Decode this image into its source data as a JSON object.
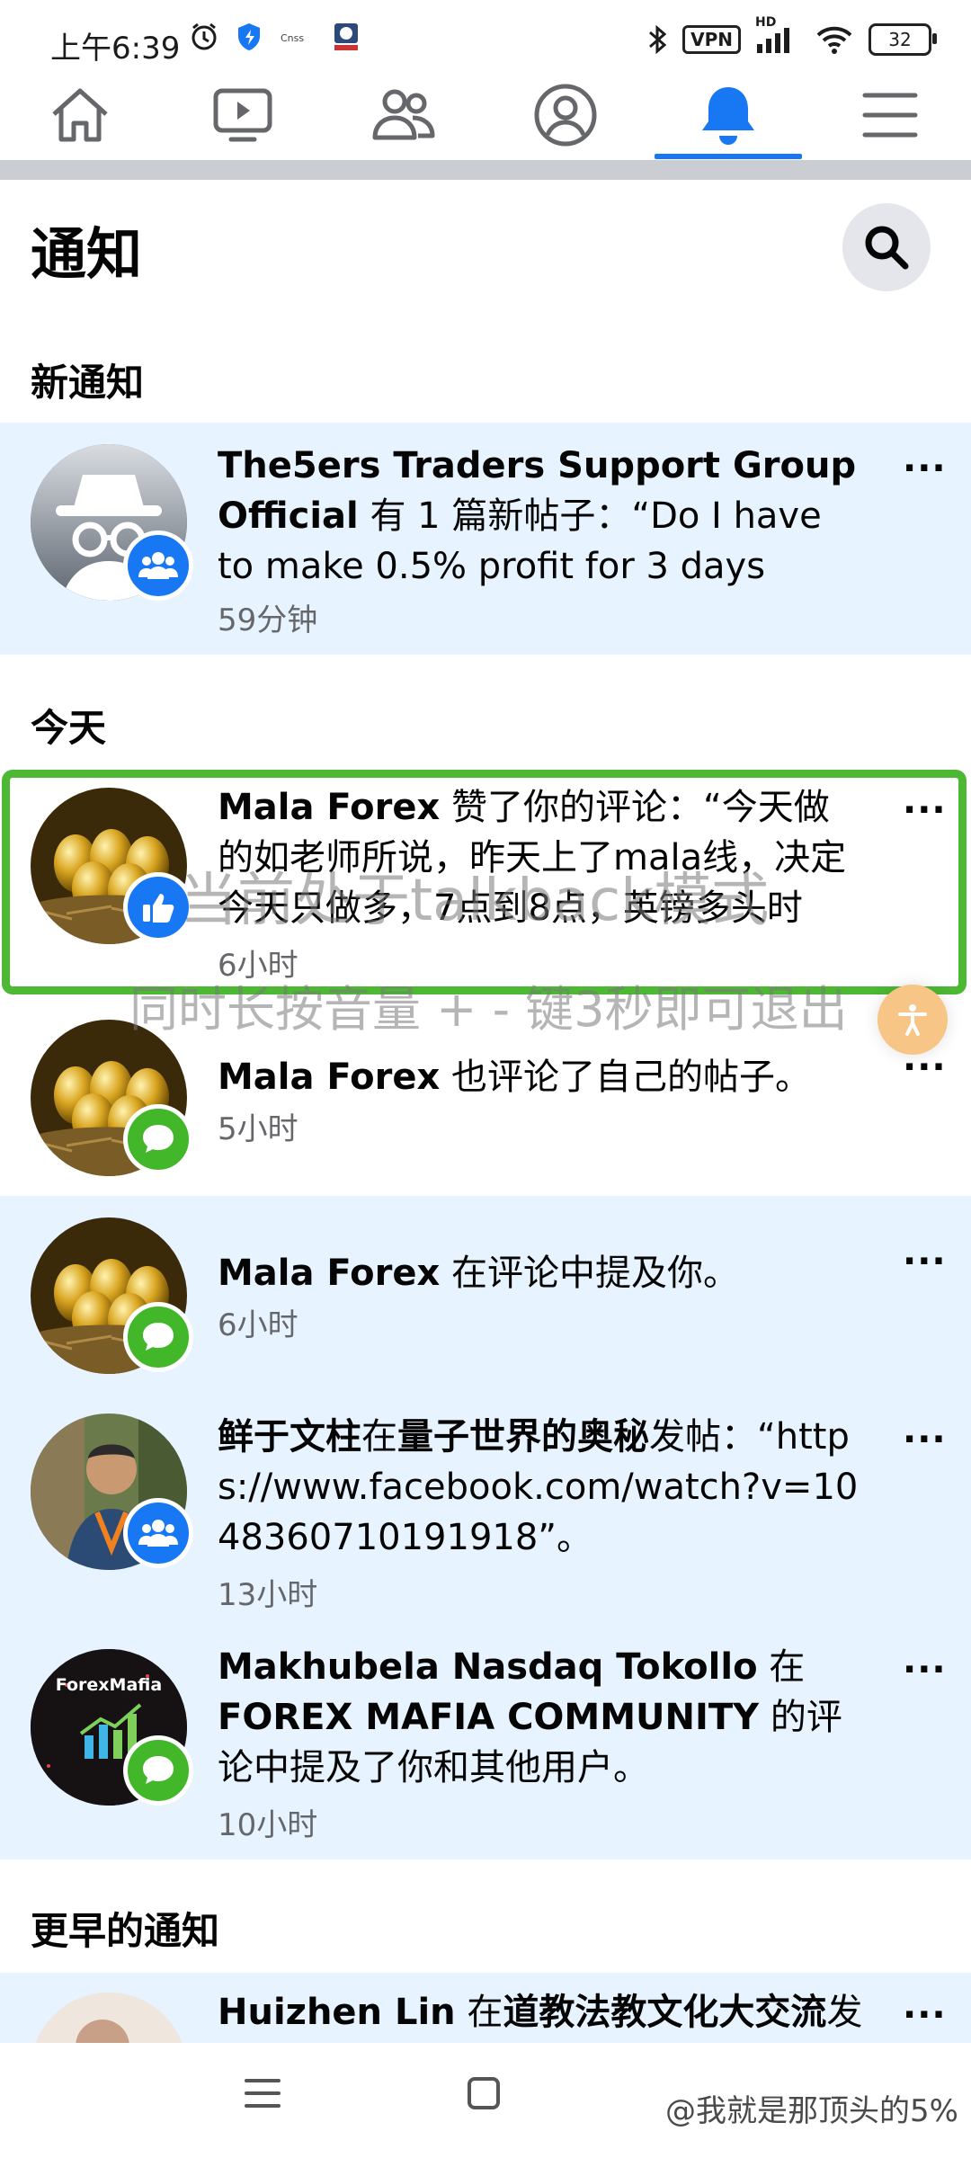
{
  "status_bar": {
    "time": "上午6:39",
    "vpn": "VPN",
    "hd": "HD",
    "battery": "32"
  },
  "nav": {
    "items": [
      "home",
      "video",
      "groups",
      "profile",
      "notifications",
      "menu"
    ],
    "active": "notifications",
    "accent": "#1877f2"
  },
  "header": {
    "title": "通知"
  },
  "sections": {
    "new": "新通知",
    "today": "今天",
    "earlier": "更早的通知"
  },
  "notifications": [
    {
      "name": "The5ers Traders Support Group Official",
      "text": " 有 1 篇新帖子：“Do I have to make 0.5% profit for 3 days before …",
      "time": "59分钟",
      "badge": "groups-icon",
      "unread": true
    },
    {
      "name": "Mala Forex",
      "text": " 赞了你的评论：“今天做的如老师所说，昨天上了mala线，决定今天只做多，7点到8点，英镑多头时间…",
      "time": "6小时",
      "badge": "like-icon",
      "unread": false
    },
    {
      "name": "Mala Forex",
      "text": " 也评论了自己的帖子。",
      "time": "5小时",
      "badge": "comment-icon",
      "unread": false
    },
    {
      "name": "Mala Forex",
      "text": " 在评论中提及你。",
      "time": "6小时",
      "badge": "comment-icon",
      "unread": true
    },
    {
      "name": "鲜于文柱",
      "text_mid": "在",
      "name2": "量子世界的奥秘",
      "text": "发帖：“https://www.facebook.com/watch?v=1048360710191918”。",
      "time": "13小时",
      "badge": "groups-icon",
      "unread": true
    },
    {
      "name": "Makhubela Nasdaq Tokollo",
      "text_mid": " 在 ",
      "name2": "FOREX MAFIA COMMUNITY",
      "text": " 的评论中提及了你和其他用户。",
      "time": "10小时",
      "badge": "comment-icon",
      "unread": true
    },
    {
      "name": "Huizhen Lin",
      "text_mid": " 在",
      "name2": "道教法教文化大交流",
      "text": "发",
      "time": "",
      "badge": "",
      "unread": true
    }
  ],
  "overlay": {
    "line1": "当前处于talkback模式",
    "line2": "同时长按音量 + - 键3秒即可退出",
    "avatar_logo_text": "ForexMafia"
  },
  "watermark": "@我就是那顶头的5%",
  "more_label": "···"
}
